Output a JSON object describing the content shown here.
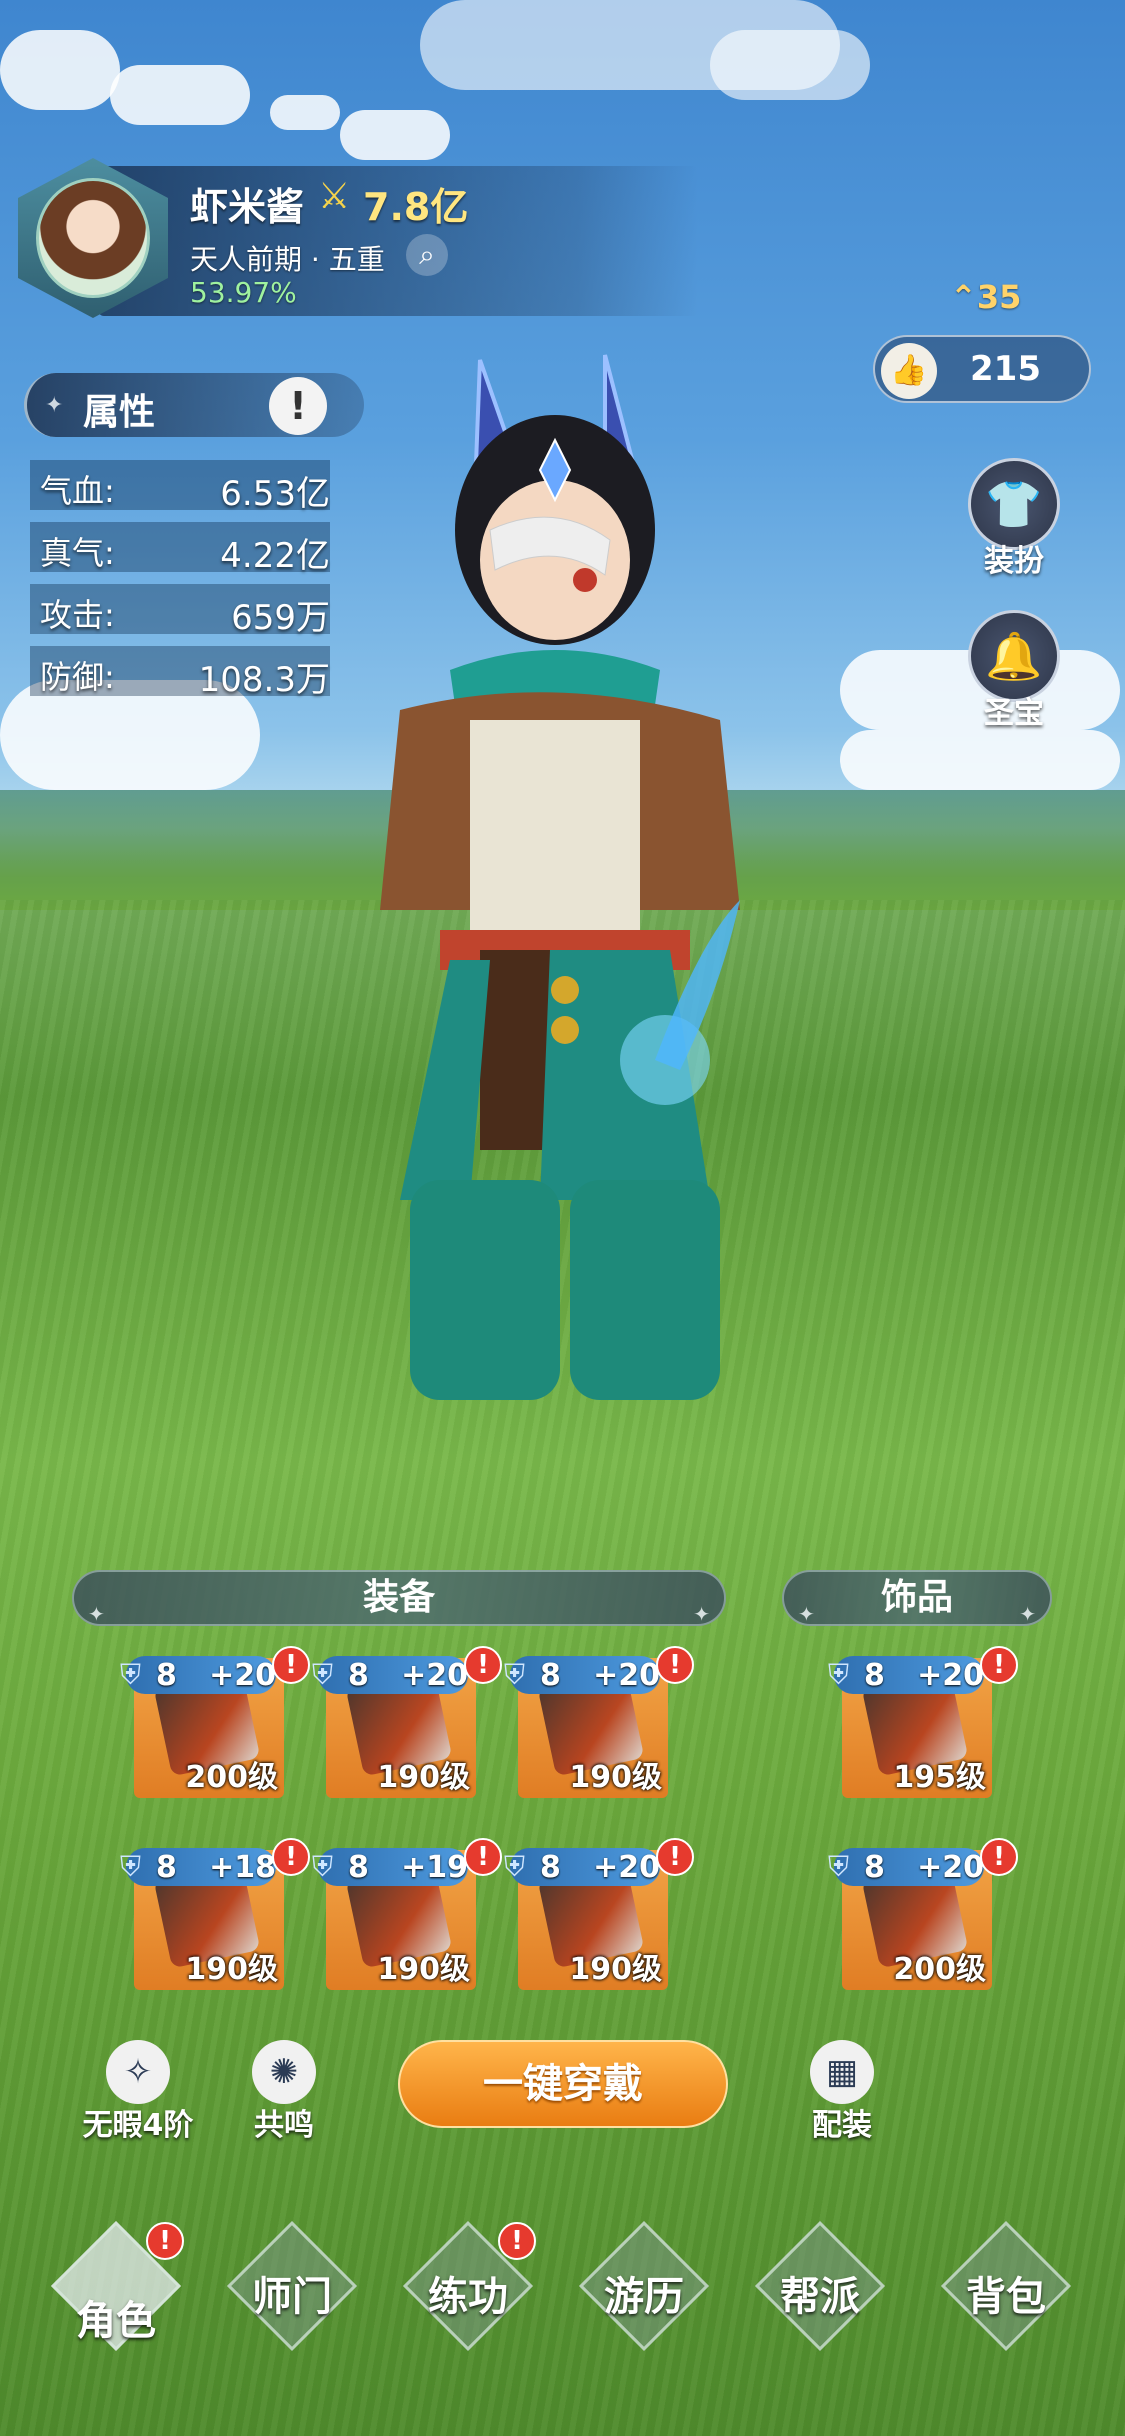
{
  "player": {
    "name": "虾米酱",
    "power": "7.8亿",
    "realm": "天人前期 · 五重",
    "progress": "53.97%",
    "rank": "35",
    "likes": "215"
  },
  "side_buttons": [
    {
      "label": "装扮",
      "icon": "outfit-icon"
    },
    {
      "label": "圣宝",
      "icon": "bell-icon"
    }
  ],
  "attributes": {
    "title": "属性",
    "rows": [
      {
        "label": "气血:",
        "value": "6.53亿"
      },
      {
        "label": "真气:",
        "value": "4.22亿"
      },
      {
        "label": "攻击:",
        "value": "659万"
      },
      {
        "label": "防御:",
        "value": "108.3万"
      }
    ]
  },
  "equipment": {
    "title": "装备",
    "slots": [
      {
        "tier": "8",
        "plus": "+20",
        "level": "200级",
        "alert": "!"
      },
      {
        "tier": "8",
        "plus": "+20",
        "level": "190级",
        "alert": "!"
      },
      {
        "tier": "8",
        "plus": "+20",
        "level": "190级",
        "alert": "!"
      },
      {
        "tier": "8",
        "plus": "+18",
        "level": "190级",
        "alert": "!"
      },
      {
        "tier": "8",
        "plus": "+19",
        "level": "190级",
        "alert": "!"
      },
      {
        "tier": "8",
        "plus": "+20",
        "level": "190级",
        "alert": "!"
      }
    ]
  },
  "accessories": {
    "title": "饰品",
    "slots": [
      {
        "tier": "8",
        "plus": "+20",
        "level": "195级",
        "alert": "!"
      },
      {
        "tier": "8",
        "plus": "+20",
        "level": "200级",
        "alert": "!"
      }
    ]
  },
  "actions": {
    "flawless": "无暇4阶",
    "resonance": "共鸣",
    "equip_all": "一键穿戴",
    "loadout": "配装"
  },
  "nav": [
    {
      "label": "角色",
      "alert": "!"
    },
    {
      "label": "师门",
      "alert": ""
    },
    {
      "label": "练功",
      "alert": "!"
    },
    {
      "label": "游历",
      "alert": ""
    },
    {
      "label": "帮派",
      "alert": ""
    },
    {
      "label": "背包",
      "alert": ""
    }
  ],
  "colors": {
    "accent_orange": "#e97d12",
    "tier_blue": "#2f6fb0",
    "alert_red": "#e63a2e",
    "progress_green": "#9ff29f"
  }
}
